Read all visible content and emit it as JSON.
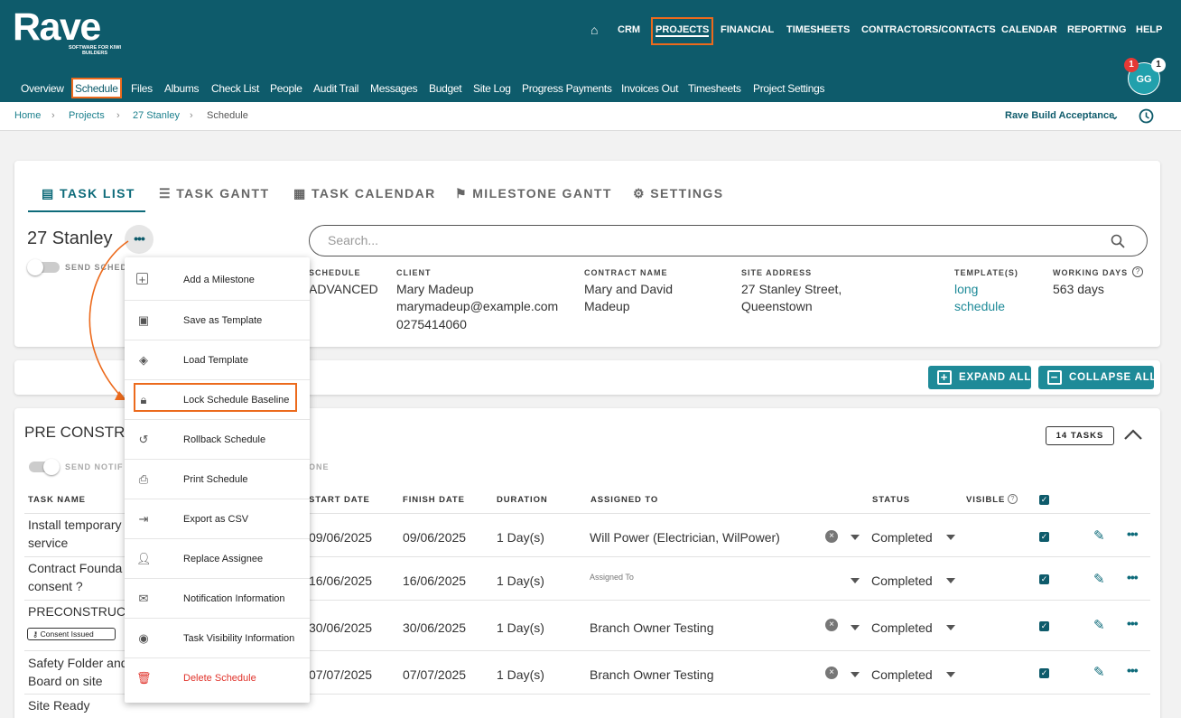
{
  "brand": {
    "logo": "Rave",
    "tagline": "SOFTWARE FOR KIWI BUILDERS"
  },
  "main_nav": [
    "CRM",
    "PROJECTS",
    "FINANCIAL",
    "TIMESHEETS",
    "CONTRACTORS/CONTACTS",
    "CALENDAR",
    "REPORTING",
    "HELP"
  ],
  "sub_nav": [
    "Overview",
    "Schedule",
    "Files",
    "Albums",
    "Check List",
    "People",
    "Audit Trail",
    "Messages",
    "Budget",
    "Site Log",
    "Progress Payments",
    "Invoices Out",
    "Timesheets",
    "Project Settings"
  ],
  "user": {
    "initials": "GG",
    "notif_red": "1",
    "notif_white": "1"
  },
  "breadcrumb": [
    "Home",
    "Projects",
    "27 Stanley",
    "Schedule"
  ],
  "company": "Rave Build Acceptance",
  "tabs": [
    "TASK LIST",
    "TASK GANTT",
    "TASK CALENDAR",
    "MILESTONE GANTT",
    "SETTINGS"
  ],
  "project": {
    "title": "27 Stanley",
    "toggle_label": "SEND SCHED",
    "search_placeholder": "Search...",
    "schedule_label": "SCHEDULE",
    "schedule_value": "ADVANCED",
    "client_label": "CLIENT",
    "client_name": "Mary Madeup",
    "client_email": "marymadeup@example.com",
    "client_phone": "0275414060",
    "contract_label": "CONTRACT NAME",
    "contract_line1": "Mary and David",
    "contract_line2": "Madeup",
    "site_label": "SITE ADDRESS",
    "site_line1": "27 Stanley Street,",
    "site_line2": "Queenstown",
    "template_label": "TEMPLATE(S)",
    "template_line1": "long",
    "template_line2": "schedule",
    "working_label": "WORKING DAYS",
    "working_value": "563 days"
  },
  "actions": {
    "expand": "EXPAND ALL",
    "collapse": "COLLAPSE ALL"
  },
  "section": {
    "title": "PRE CONSTRU",
    "toggle_label": "SEND NOTIF",
    "toggle_suffix": "ONE",
    "tasks_badge": "14 TASKS"
  },
  "table_headers": [
    "TASK NAME",
    "START DATE",
    "FINISH DATE",
    "DURATION",
    "ASSIGNED TO",
    "STATUS",
    "VISIBLE"
  ],
  "rows": [
    {
      "name1": "Install temporary",
      "name2": "service",
      "start": "09/06/2025",
      "finish": "09/06/2025",
      "duration": "1 Day(s)",
      "assigned": "Will Power (Electrician, WilPower)",
      "status": "Completed"
    },
    {
      "name1": "Contract Founda",
      "name2": "consent ?",
      "start": "16/06/2025",
      "finish": "16/06/2025",
      "duration": "1 Day(s)",
      "assigned": "Assigned To",
      "status": "Completed"
    },
    {
      "name1": "PRECONSTRUCT",
      "tag": "Consent Issued",
      "start": "30/06/2025",
      "finish": "30/06/2025",
      "duration": "1 Day(s)",
      "assigned": "Branch Owner Testing",
      "status": "Completed"
    },
    {
      "name1": "Safety Folder and",
      "name2": "Board on site",
      "start": "07/07/2025",
      "finish": "07/07/2025",
      "duration": "1 Day(s)",
      "assigned": "Branch Owner Testing",
      "status": "Completed"
    },
    {
      "name1": "Site Ready"
    }
  ],
  "menu": [
    "Add a Milestone",
    "Save as Template",
    "Load Template",
    "Lock Schedule Baseline",
    "Rollback Schedule",
    "Print Schedule",
    "Export as CSV",
    "Replace Assignee",
    "Notification Information",
    "Task Visibility Information",
    "Delete Schedule"
  ],
  "colors": {
    "header": "#0e5b6b",
    "accent": "#1e8a98",
    "highlight": "#ec6a1c",
    "danger": "#e0332b"
  }
}
